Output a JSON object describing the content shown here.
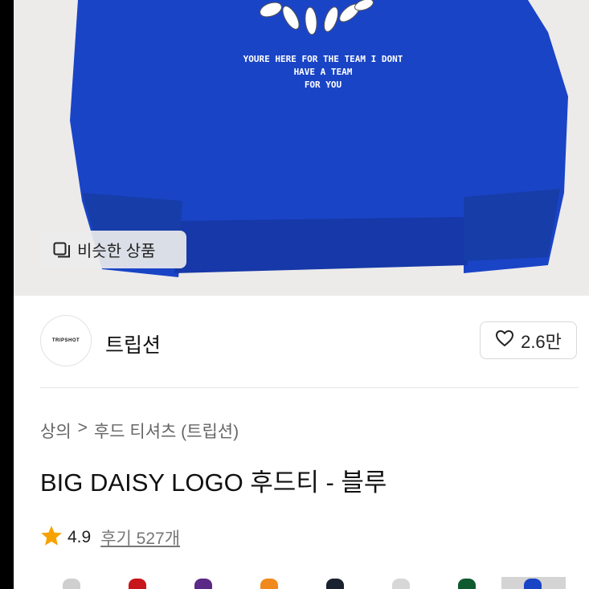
{
  "hero": {
    "print_text": [
      "YOURE HERE FOR THE TEAM I DONT",
      "HAVE A TEAM",
      "FOR YOU"
    ],
    "similar_button": {
      "icon": "similar-items-icon",
      "label": "비슷한 상품"
    }
  },
  "brand": {
    "logo_text": "TRIPSHOT",
    "name": "트립션",
    "like": {
      "icon": "heart-icon",
      "count": "2.6만"
    }
  },
  "breadcrumb": {
    "items": [
      "상의",
      "후드 티셔츠 (트립션)"
    ],
    "separator": ">"
  },
  "product": {
    "title": "BIG DAISY LOGO 후드티 - 블루",
    "rating": {
      "icon": "star-icon",
      "score": "4.9",
      "reviews": "후기 527개"
    }
  },
  "colors": {
    "hoodie": "#1a44c6",
    "star": "#f6a300",
    "swatches": [
      "#cfcfcf",
      "#c8161d",
      "#5b2a86",
      "#f08a1c",
      "#1a2230",
      "#d7d7d7",
      "#0f5a2e",
      "#1a44c6"
    ]
  }
}
